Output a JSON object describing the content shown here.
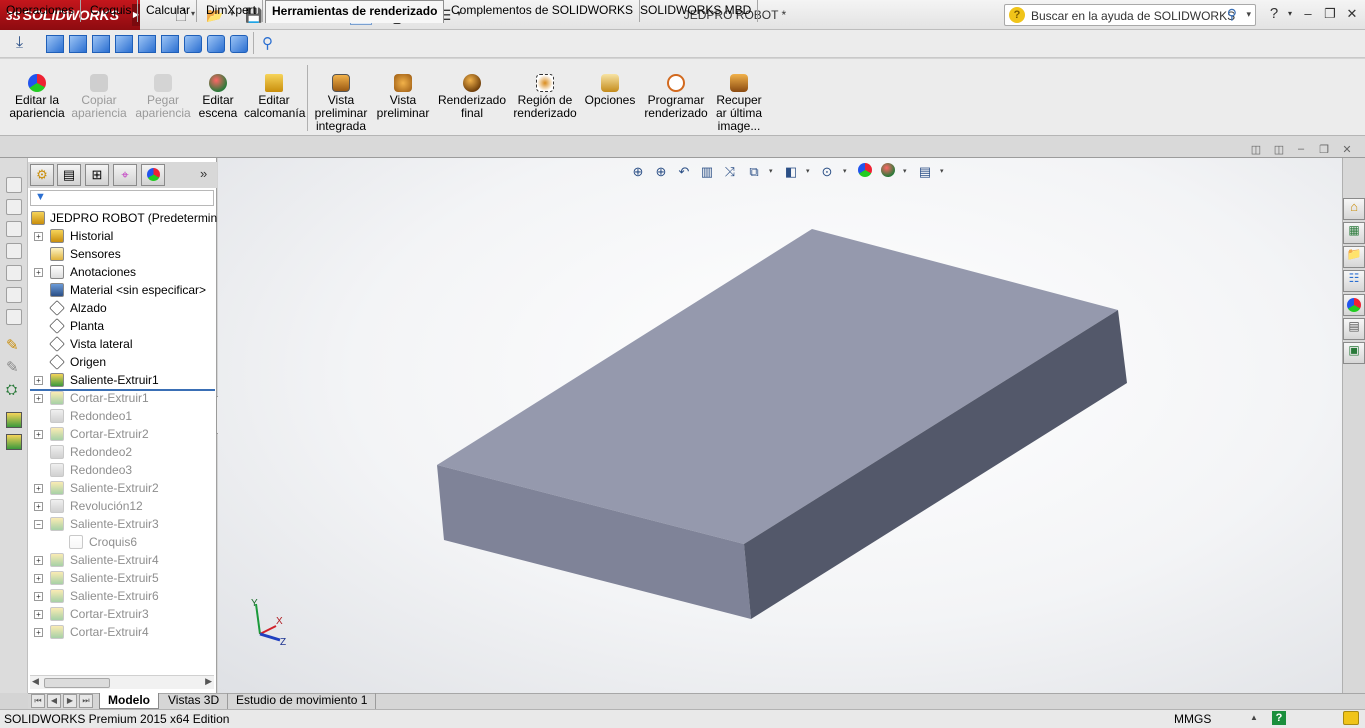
{
  "app": {
    "brand": "SOLIDWORKS",
    "brand_prefix": "3S",
    "document_title": "JEDPRO ROBOT *"
  },
  "help_search": {
    "placeholder": "Buscar en la ayuda de SOLIDWORKS"
  },
  "command_manager": {
    "buttons": [
      {
        "label": "Editar la\napariencia",
        "enabled": true
      },
      {
        "label": "Copiar\napariencia",
        "enabled": false
      },
      {
        "label": "Pegar\napariencia",
        "enabled": false
      },
      {
        "label": "Editar\nescena",
        "enabled": true
      },
      {
        "label": "Editar\ncalcomanía",
        "enabled": true
      },
      {
        "label": "Vista\npreliminar\nintegrada",
        "enabled": true
      },
      {
        "label": "Vista\npreliminar",
        "enabled": true
      },
      {
        "label": "Renderizado\nfinal",
        "enabled": true
      },
      {
        "label": "Región de\nrenderizado",
        "enabled": true
      },
      {
        "label": "Opciones",
        "enabled": true
      },
      {
        "label": "Programar\nrenderizado",
        "enabled": true
      },
      {
        "label": "Recuper\nar última\nimage...",
        "enabled": true
      }
    ]
  },
  "tabs": [
    {
      "label": "Operaciones"
    },
    {
      "label": "Croquis"
    },
    {
      "label": "Calcular"
    },
    {
      "label": "DimXpert"
    },
    {
      "label": "Herramientas de renderizado",
      "active": true
    },
    {
      "label": "Complementos de SOLIDWORKS"
    },
    {
      "label": "SOLIDWORKS MBD"
    }
  ],
  "feature_tree": {
    "root": "JEDPRO ROBOT  (Predeterminado",
    "items": [
      {
        "label": "Historial",
        "expandable": true,
        "dim": false,
        "icon": "history-icon"
      },
      {
        "label": "Sensores",
        "expandable": false,
        "dim": false,
        "icon": "sensor-icon"
      },
      {
        "label": "Anotaciones",
        "expandable": true,
        "dim": false,
        "icon": "annotation-icon"
      },
      {
        "label": "Material <sin especificar>",
        "expandable": false,
        "dim": false,
        "icon": "material-icon"
      },
      {
        "label": "Alzado",
        "expandable": false,
        "dim": false,
        "icon": "plane-icon"
      },
      {
        "label": "Planta",
        "expandable": false,
        "dim": false,
        "icon": "plane-icon"
      },
      {
        "label": "Vista lateral",
        "expandable": false,
        "dim": false,
        "icon": "plane-icon"
      },
      {
        "label": "Origen",
        "expandable": false,
        "dim": false,
        "icon": "origin-icon"
      },
      {
        "label": "Saliente-Extruir1",
        "expandable": true,
        "dim": false,
        "icon": "extrude-icon"
      },
      {
        "label": "Cortar-Extruir1",
        "expandable": true,
        "dim": true,
        "icon": "cut-icon"
      },
      {
        "label": "Redondeo1",
        "expandable": false,
        "dim": true,
        "icon": "fillet-icon"
      },
      {
        "label": "Cortar-Extruir2",
        "expandable": true,
        "dim": true,
        "icon": "cut-icon"
      },
      {
        "label": "Redondeo2",
        "expandable": false,
        "dim": true,
        "icon": "fillet-icon"
      },
      {
        "label": "Redondeo3",
        "expandable": false,
        "dim": true,
        "icon": "fillet-icon"
      },
      {
        "label": "Saliente-Extruir2",
        "expandable": true,
        "dim": true,
        "icon": "extrude-icon"
      },
      {
        "label": "Revolución12",
        "expandable": true,
        "dim": true,
        "icon": "revolve-icon"
      },
      {
        "label": "Saliente-Extruir3",
        "expandable": true,
        "expanded": true,
        "dim": true,
        "icon": "extrude-icon"
      },
      {
        "label": "Croquis6",
        "expandable": false,
        "dim": true,
        "icon": "sketch-icon",
        "child": true
      },
      {
        "label": "Saliente-Extruir4",
        "expandable": true,
        "dim": true,
        "icon": "extrude-icon"
      },
      {
        "label": "Saliente-Extruir5",
        "expandable": true,
        "dim": true,
        "icon": "extrude-icon"
      },
      {
        "label": "Saliente-Extruir6",
        "expandable": true,
        "dim": true,
        "icon": "extrude-icon"
      },
      {
        "label": "Cortar-Extruir3",
        "expandable": true,
        "dim": true,
        "icon": "cut-icon"
      },
      {
        "label": "Cortar-Extruir4",
        "expandable": true,
        "dim": true,
        "icon": "cut-icon"
      }
    ]
  },
  "bottom_tabs": [
    {
      "label": "Modelo",
      "active": true
    },
    {
      "label": "Vistas 3D"
    },
    {
      "label": "Estudio de movimiento 1"
    }
  ],
  "triad": {
    "x": "X",
    "y": "Y",
    "z": "Z"
  },
  "status": {
    "text": "SOLIDWORKS Premium 2015 x64 Edition",
    "units": "MMGS"
  },
  "colors": {
    "brand_red": "#c4161c",
    "model_top": "#9599ad",
    "model_front": "#7f8398",
    "model_side": "#53586a"
  }
}
